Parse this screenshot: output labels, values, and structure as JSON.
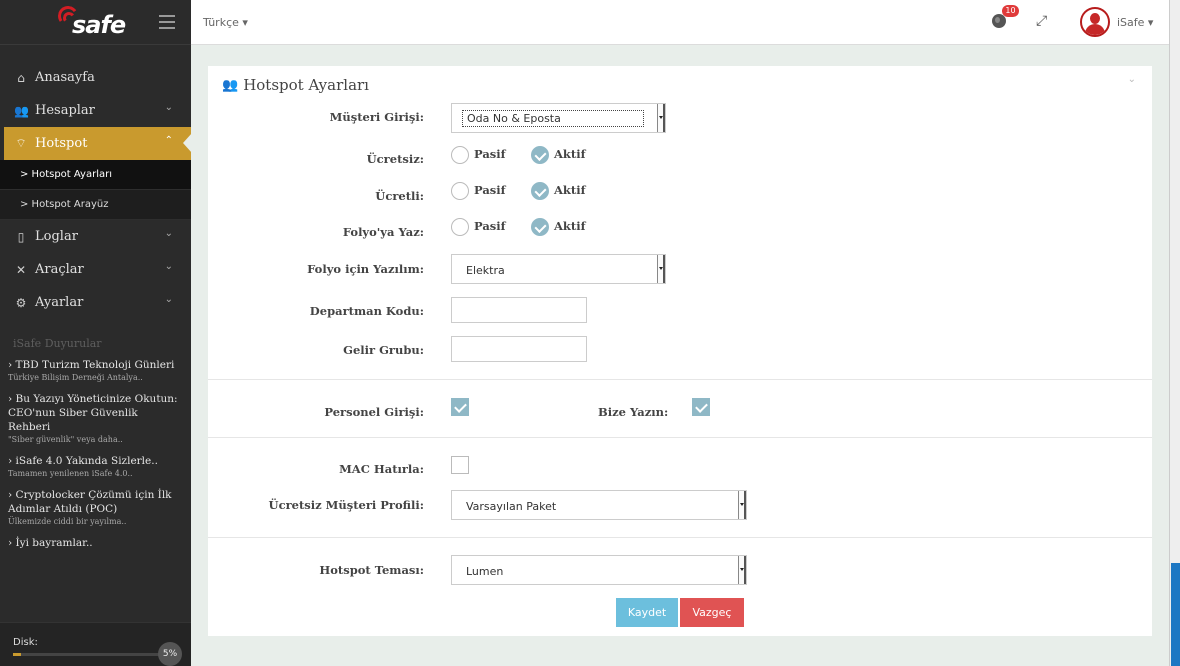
{
  "brand": {
    "logo_text": "safe"
  },
  "sidebar": {
    "items": [
      {
        "label": "Anasayfa",
        "icon": "home-icon"
      },
      {
        "label": "Hesaplar",
        "icon": "users-icon"
      },
      {
        "label": "Hotspot",
        "icon": "wifi-icon",
        "active": true
      },
      {
        "label": "Loglar",
        "icon": "file-icon"
      },
      {
        "label": "Araçlar",
        "icon": "tools-icon"
      },
      {
        "label": "Ayarlar",
        "icon": "gears-icon"
      }
    ],
    "hotspot_sub": [
      {
        "label": "> Hotspot Ayarları"
      },
      {
        "label": "> Hotspot Arayüz"
      }
    ],
    "news_title": "iSafe Duyurular",
    "news": [
      {
        "title": "› TBD Turizm Teknoloji Günleri",
        "sub": "Türkiye Bilişim Derneği Antalya.."
      },
      {
        "title": "› Bu Yazıyı Yöneticinize Okutun: CEO'nun Siber Güvenlik Rehberi",
        "sub": "\"Siber güvenlik\" veya daha.."
      },
      {
        "title": "› iSafe 4.0 Yakında Sizlerle..",
        "sub": "Tamamen yenilenen iSafe 4.0.."
      },
      {
        "title": "› Cryptolocker Çözümü için İlk Adımlar Atıldı (POC)",
        "sub": "Ülkemizde ciddi bir yayılma.."
      },
      {
        "title": "› İyi bayramlar..",
        "sub": ""
      }
    ],
    "disk_label": "Disk:",
    "disk_percent": "5%",
    "disk_value": 5
  },
  "topbar": {
    "language": "Türkçe ▾",
    "notification_count": "10",
    "username": "iSafe ▾"
  },
  "panel": {
    "title": "Hotspot Ayarları",
    "fields": {
      "musteri_girisi": {
        "label": "Müşteri Girişi:",
        "value": "Oda No & Eposta"
      },
      "ucretsiz": {
        "label": "Ücretsiz:",
        "off": "Pasif",
        "on": "Aktif",
        "selected": "Aktif"
      },
      "ucretli": {
        "label": "Ücretli:",
        "off": "Pasif",
        "on": "Aktif",
        "selected": "Aktif"
      },
      "folyoya_yaz": {
        "label": "Folyo'ya Yaz:",
        "off": "Pasif",
        "on": "Aktif",
        "selected": "Aktif"
      },
      "folyo_yazilim": {
        "label": "Folyo için Yazılım:",
        "value": "Elektra"
      },
      "departman_kodu": {
        "label": "Departman Kodu:",
        "value": ""
      },
      "gelir_grubu": {
        "label": "Gelir Grubu:",
        "value": ""
      },
      "personel_girisi": {
        "label": "Personel Girişi:",
        "checked": true
      },
      "bize_yazin": {
        "label": "Bize Yazın:",
        "checked": true
      },
      "mac_hatirla": {
        "label": "MAC Hatırla:",
        "checked": false
      },
      "ucretsiz_profil": {
        "label": "Ücretsiz Müşteri Profili:",
        "value": "Varsayılan Paket"
      },
      "hotspot_temasi": {
        "label": "Hotspot Teması:",
        "value": "Lumen"
      }
    },
    "buttons": {
      "save": "Kaydet",
      "cancel": "Vazgeç"
    }
  },
  "colors": {
    "accent": "#c99a2e",
    "sidebar_bg": "#2b2b2b",
    "save": "#6cbfdd",
    "cancel": "#e05353",
    "check": "#8fb8c6"
  }
}
